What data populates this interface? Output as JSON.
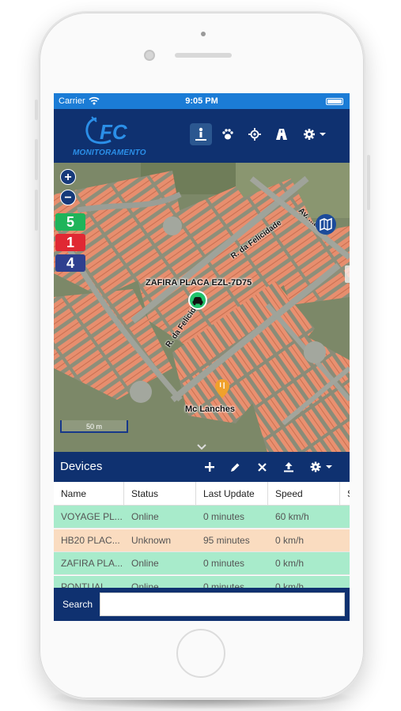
{
  "status_bar": {
    "carrier": "Carrier",
    "time": "9:05 PM"
  },
  "app": {
    "logo_text": "MONITORAMENTO"
  },
  "toolbar": {
    "icons": [
      "person-pin-icon",
      "paw-icon",
      "crosshair-icon",
      "road-icon",
      "gear-icon"
    ]
  },
  "map": {
    "zoom_in": "+",
    "zoom_out": "−",
    "badges": [
      {
        "value": "5",
        "color": "#1fb45a"
      },
      {
        "value": "1",
        "color": "#e02833"
      },
      {
        "value": "4",
        "color": "#2e3f8f"
      }
    ],
    "vehicle_label": "ZAFIRA PLACA EZL-7D75",
    "poi_label": "Mc Lanches",
    "streets": [
      "R. da Felicidade",
      "R. da Felicidade",
      "Av. ...az"
    ],
    "scale": "50 m"
  },
  "devices": {
    "title": "Devices",
    "columns": [
      "Name",
      "Status",
      "Last Update",
      "Speed",
      "S"
    ],
    "rows": [
      {
        "name": "VOYAGE PL...",
        "status": "Online",
        "last_update": "0 minutes",
        "speed": "60 km/h",
        "color": "#a8ebcb"
      },
      {
        "name": "HB20 PLAC...",
        "status": "Unknown",
        "last_update": "95 minutes",
        "speed": "0 km/h",
        "color": "#fadcc0"
      },
      {
        "name": "ZAFIRA PLA...",
        "status": "Online",
        "last_update": "0 minutes",
        "speed": "0 km/h",
        "color": "#a8ebcb"
      },
      {
        "name": "PONTUAL...",
        "status": "Online",
        "last_update": "0 minutes",
        "speed": "0 km/h",
        "color": "#a8ebcb"
      }
    ]
  },
  "search": {
    "label": "Search",
    "value": ""
  }
}
